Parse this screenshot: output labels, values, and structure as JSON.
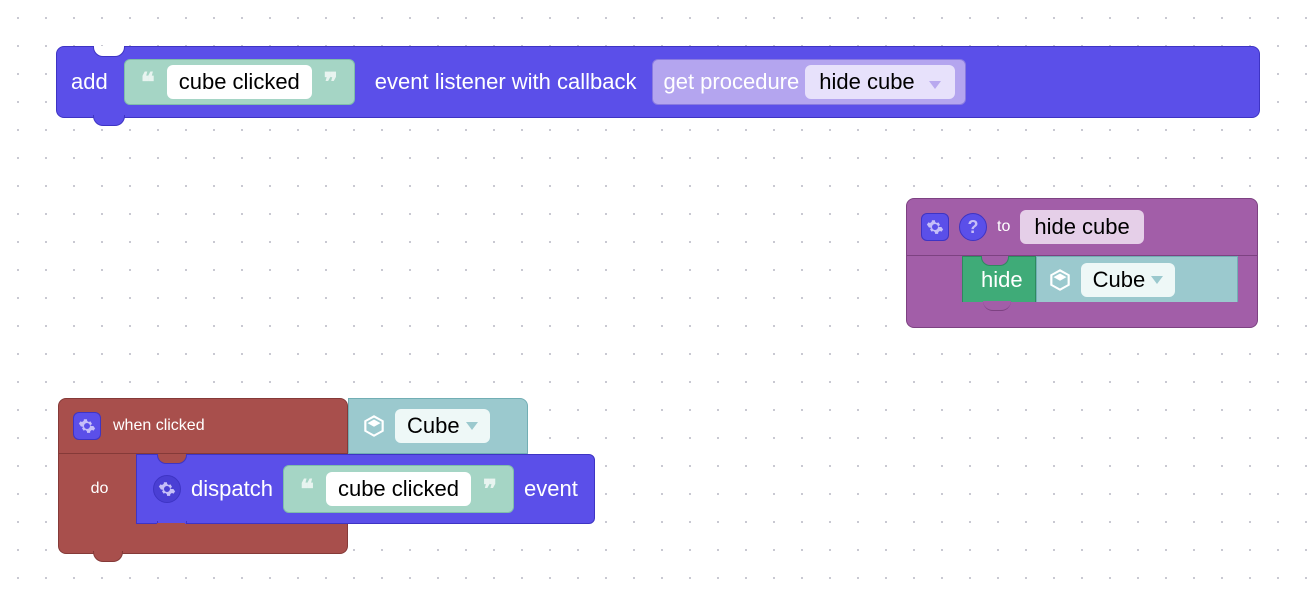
{
  "add_block": {
    "add_label": "add",
    "event_name": "cube clicked",
    "middle_label": "event listener with callback",
    "get_proc_label": "get procedure",
    "proc_name": "hide cube"
  },
  "proc_def": {
    "to_label": "to",
    "proc_name": "hide cube",
    "hide_label": "hide",
    "object_name": "Cube"
  },
  "when_block": {
    "when_label": "when clicked",
    "object_name": "Cube",
    "do_label": "do",
    "dispatch_label": "dispatch",
    "event_name": "cube clicked",
    "event_suffix": "event"
  }
}
